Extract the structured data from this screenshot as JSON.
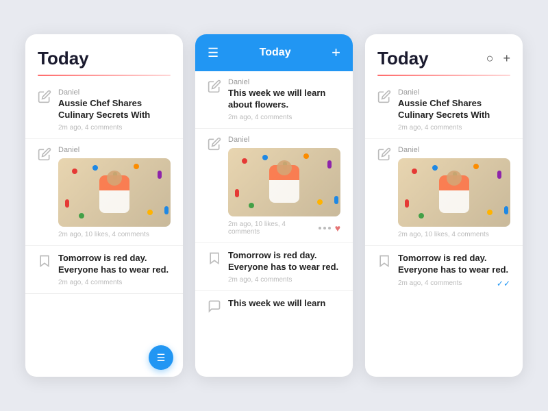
{
  "panels": [
    {
      "id": "panel1",
      "title": "Today",
      "items": [
        {
          "type": "text",
          "author": "Daniel",
          "title": "Aussie Chef Shares Culinary Secrets With",
          "meta": "2m ago, 4 comments",
          "icon": "pencil"
        },
        {
          "type": "image",
          "author": "Daniel",
          "meta": "2m ago, 10 likes, 4 comments",
          "icon": "pencil"
        },
        {
          "type": "text",
          "title": "Tomorrow is red day. Everyone has to wear red.",
          "meta": "2m ago, 4 comments",
          "icon": "bookmark"
        }
      ]
    },
    {
      "id": "panel2",
      "title": "Today",
      "items": [
        {
          "type": "text",
          "author": "Daniel",
          "title": "This week we will learn about flowers.",
          "meta": "2m ago, 4 comments",
          "icon": "pencil"
        },
        {
          "type": "image",
          "author": "Daniel",
          "meta": "2m ago, 10 likes, 4 comments",
          "has_actions": true,
          "icon": "pencil"
        },
        {
          "type": "text",
          "title": "Tomorrow is red day. Everyone has to wear red.",
          "meta": "2m ago, 4 comments",
          "icon": "bookmark"
        },
        {
          "type": "text_partial",
          "author": "",
          "title": "This week we will learn",
          "icon": "chat"
        }
      ]
    },
    {
      "id": "panel3",
      "title": "Today",
      "items": [
        {
          "type": "text",
          "author": "Daniel",
          "title": "Aussie Chef Shares Culinary Secrets With",
          "meta": "2m ago, 4 comments",
          "icon": "pencil"
        },
        {
          "type": "image",
          "author": "Daniel",
          "meta": "2m ago, 10 likes, 4 comments",
          "icon": "pencil"
        },
        {
          "type": "text",
          "title": "Tomorrow is red day. Everyone has to wear red.",
          "meta": "2m ago, 4 comments",
          "has_check": true,
          "icon": "bookmark"
        }
      ]
    }
  ],
  "icons": {
    "menu": "☰",
    "plus": "+",
    "search": "○",
    "fab_menu": "☰",
    "check": "✓"
  }
}
